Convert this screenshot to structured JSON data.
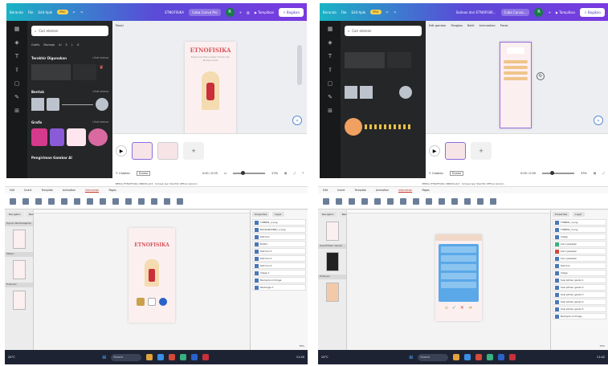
{
  "canva1": {
    "menu": [
      "Beranda",
      "File"
    ],
    "edit_label": "Edit Apik",
    "doc_title": "ETNOFISIKA",
    "trial_label": "Coba Canva Pro",
    "avatar": "R",
    "present_label": "Tampilkan",
    "share_label": "Bagikan",
    "search_placeholder": "Cari elemen",
    "filters": [
      "Grafis",
      "Momaja",
      "Ai",
      "S",
      "L",
      "G"
    ],
    "section1": "Terakhir Digunakan",
    "section2": "Bentuk",
    "section3": "Grafis",
    "section4": "Pengiriman Gambar AI",
    "see_all": "Lihat semua",
    "canvas_label": "Posisi",
    "poster_title": "ETNOFISIKA",
    "poster_sub": "Eksplorasi Fisika dalam Tradisi dan Budaya Lokal",
    "notes_label": "Catatan",
    "timer_label": "Durasi",
    "time": "0:00 / 0:05",
    "zoom": "23%",
    "pages": "5"
  },
  "canva2": {
    "menu": [
      "Beranda",
      "File"
    ],
    "edit_label": "Edit Apik",
    "doc_title": "Salinan dari ETNOFISIK...",
    "trial_label": "Coba Canva...",
    "avatar": "R",
    "present_label": "Tampilkan",
    "share_label": "Bagikan",
    "toolbar": [
      "Edit gambar",
      "Pangkas",
      "Balik",
      "Animasikan",
      "Posisi"
    ],
    "search_placeholder": "Cari elemen",
    "notes_label": "Catatan",
    "timer_label": "Durasi",
    "time": "0:00 / 0:05",
    "zoom": "33%"
  },
  "storyline1": {
    "title": "MEDIA ETNOFISIKA UBRISS.sb3 - Simpel Ajar Stanfdk Offline Version",
    "tabs": [
      "Edit",
      "Insert",
      "Template",
      "Animation",
      "Interaction",
      "Pages"
    ],
    "active_tab": "Interaction",
    "panel_tabs": [
      "Navigator",
      "Resources"
    ],
    "right_tabs": [
      "Properties",
      "Layer"
    ],
    "layers": [
      "TOMBOL_1.png",
      "BACKGROUND1_1.png",
      "Text box",
      "Button",
      "Text box 3",
      "Text box 2",
      "Text box 5",
      "Image 1",
      "Background Image",
      "Rectangle 1"
    ],
    "groups": [
      "Tujuan Pembelajaran",
      "Materi",
      "Evaluasi"
    ],
    "poster_title": "ETNOFISIKA",
    "zoom": "70%",
    "search": "Search",
    "weather": "24°C",
    "time": "11:40"
  },
  "storyline2": {
    "title": "MEDIA ETNOFISIKA UBRISS.sb3 - Simpel Ajar Stanfdk Offline Version",
    "tabs": [
      "Edit",
      "Insert",
      "Template",
      "Animation",
      "Interaction",
      "Pages"
    ],
    "active_tab": "Interaction",
    "panel_tabs": [
      "Navigator",
      "Resources"
    ],
    "right_tabs": [
      "Properties",
      "Layer"
    ],
    "layers": [
      "TOMBOL_1.png",
      "TOMBOL_2.png",
      "Image",
      "Kunci Jawaban",
      "Kunci Jawaban",
      "Kunci Jawaban",
      "Text box",
      "Image",
      "Soal pilihan ganda 1",
      "Soal pilihan ganda 2",
      "Soal pilihan ganda 3",
      "Soal pilihan ganda 4",
      "Soal pilihan ganda 5",
      "Background Image"
    ],
    "groups": [
      "Soal Pilihan Ganda",
      "Evaluasi"
    ],
    "zoom": "73%",
    "search": "Search",
    "weather": "24°C",
    "time": "11:42"
  },
  "colors": {
    "canva_gradient_start": "#19b3c4",
    "canva_gradient_end": "#7a3ae0",
    "canva_dark": "#252627",
    "poster_bg": "#fbeff0",
    "poster_title": "#d9545a",
    "quiz_blue": "#5aa8e8",
    "taskbar": "#1d2333"
  }
}
